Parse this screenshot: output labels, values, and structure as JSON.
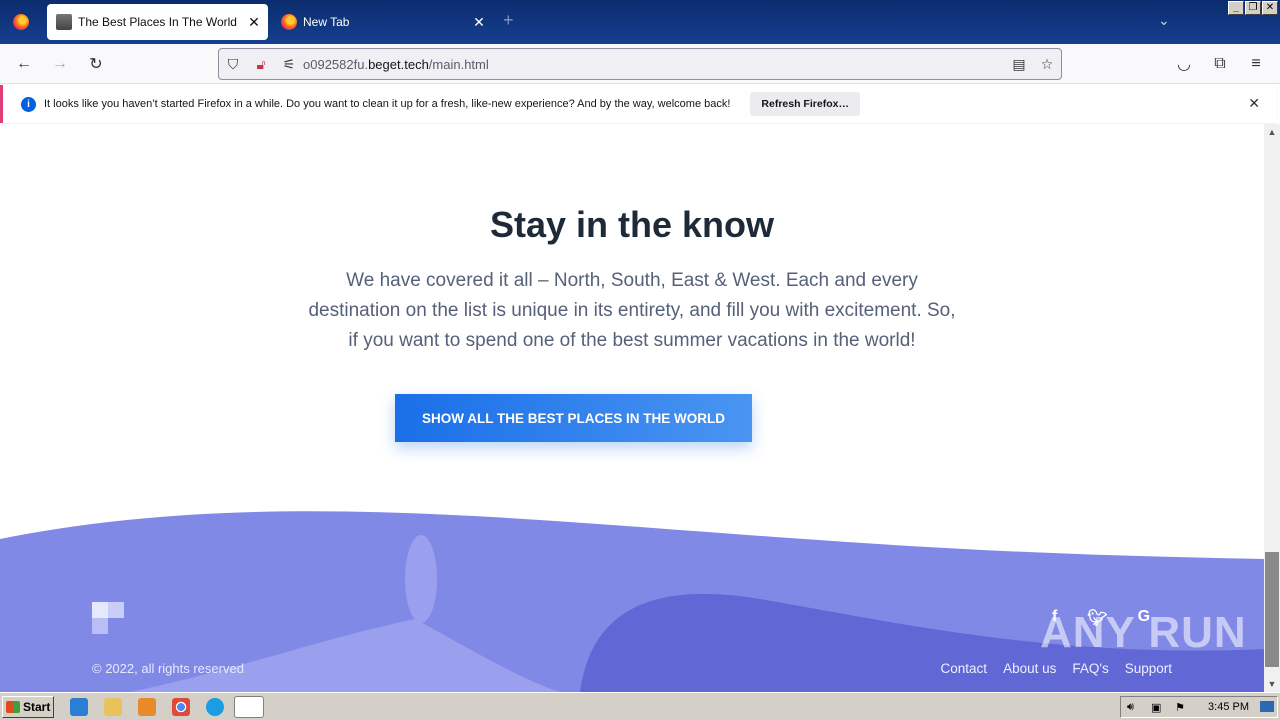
{
  "browser": {
    "tabs": [
      {
        "title": "The Best Places In The World",
        "active": true
      },
      {
        "title": "New Tab",
        "active": false
      }
    ],
    "new_tab_label": "+",
    "url": {
      "prefix": "o092582fu.",
      "host": "beget.tech",
      "path": "/main.html"
    },
    "notification": {
      "message": "It looks like you haven’t started Firefox in a while. Do you want to clean it up for a fresh, like-new experience? And by the way, welcome back!",
      "button": "Refresh Firefox…"
    }
  },
  "page": {
    "heading": "Stay in the know",
    "paragraph": "We have covered it all – North, South, East & West. Each and every destination on the list is unique in its entirety, and fill you with excitement. So, if you want to spend one of the best summer vacations in the world!",
    "cta": "SHOW ALL THE BEST PLACES IN THE WORLD",
    "footer": {
      "copyright": "© 2022, all rights reserved",
      "links": [
        "Contact",
        "About us",
        "FAQ's",
        "Support"
      ],
      "social_icons": [
        "facebook-icon",
        "twitter-icon",
        "google-icon"
      ]
    },
    "watermark": "ANY RUN"
  },
  "taskbar": {
    "start_label": "Start",
    "clock": "3:45 PM"
  },
  "colors": {
    "cta": "#1a6fe8",
    "footer_wave": "#8089e6",
    "footer_wave_dark": "#6168d6",
    "heading": "#1e2a38"
  }
}
